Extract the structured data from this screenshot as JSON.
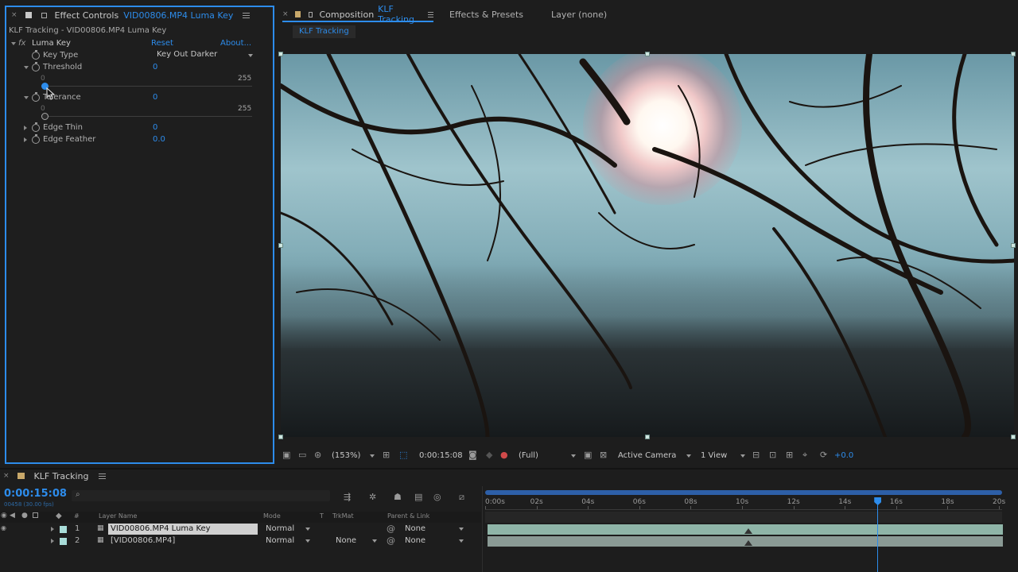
{
  "effect_controls": {
    "tab_prefix": "Effect Controls",
    "tab_layer": "VID00806.MP4 Luma Key",
    "subtitle": "KLF Tracking - VID00806.MP4 Luma Key",
    "fx_badge": "fx",
    "effect_name": "Luma Key",
    "reset_label": "Reset",
    "about_label": "About...",
    "key_type_label": "Key Type",
    "key_type_value": "Key Out Darker",
    "threshold_label": "Threshold",
    "threshold_value": "0",
    "threshold_min": "0",
    "threshold_max": "255",
    "threshold_level": 0,
    "tolerance_label": "Tolerance",
    "tolerance_value": "0",
    "tolerance_min": "0",
    "tolerance_max": "255",
    "tolerance_level": 0,
    "edge_thin_label": "Edge Thin",
    "edge_thin_value": "0",
    "edge_feather_label": "Edge Feather",
    "edge_feather_value": "0.0"
  },
  "composition": {
    "tab_prefix": "Composition",
    "tab_name": "KLF Tracking",
    "effects_presets_tab": "Effects & Presets",
    "layer_tab": "Layer (none)",
    "breadcrumb": "KLF Tracking",
    "zoom": "(153%)",
    "timecode": "0:00:15:08",
    "resolution": "(Full)",
    "camera": "Active Camera",
    "views": "1 View",
    "exposure": "+0.0"
  },
  "timeline": {
    "tab_name": "KLF Tracking",
    "timecode": "0:00:15:08",
    "frames": "00458 (30.00 fps)",
    "columns": {
      "layer_num": "#",
      "layer_name": "Layer Name",
      "mode": "Mode",
      "t": "T",
      "trkmat": "TrkMat",
      "parent": "Parent & Link"
    },
    "rulers": [
      "0:00s",
      "02s",
      "04s",
      "06s",
      "08s",
      "10s",
      "12s",
      "14s",
      "16s",
      "18s",
      "20s"
    ],
    "playhead_seconds": 15.27,
    "layers": [
      {
        "num": "1",
        "name": "VID00806.MP4 Luma Key",
        "mode": "Normal",
        "trkmat": "",
        "parent": "None"
      },
      {
        "num": "2",
        "name": "[VID00806.MP4]",
        "mode": "Normal",
        "trkmat": "None",
        "parent": "None"
      }
    ]
  },
  "colors": {
    "accent": "#2d8ceb",
    "panel_bg": "#1d1d1d",
    "track_bar": "#8fb5a8"
  }
}
